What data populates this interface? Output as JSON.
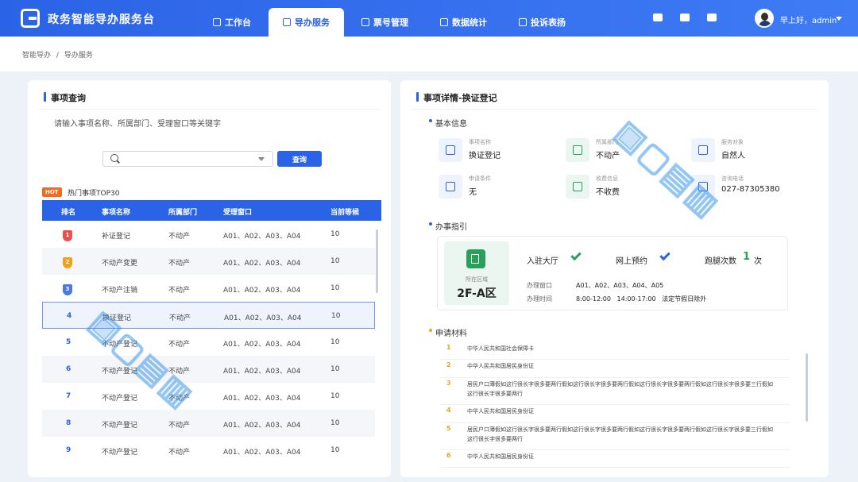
{
  "header": {
    "app_title": "政务智能导办服务台",
    "nav": [
      {
        "label": "工作台"
      },
      {
        "label": "导办服务"
      },
      {
        "label": "票号管理"
      },
      {
        "label": "数据统计"
      },
      {
        "label": "投诉表扬"
      }
    ],
    "greeting": "早上好，admin"
  },
  "breadcrumb": {
    "root": "智能导办",
    "sep": "/",
    "current": "导办服务"
  },
  "left": {
    "title": "事项查询",
    "hint": "请输入事项名称、所属部门、受理窗口等关键字",
    "search_button": "查询",
    "hot_badge": "HOT",
    "hot_title": "热门事项TOP30",
    "columns": [
      "排名",
      "事项名称",
      "所属部门",
      "受理窗口",
      "当前等候"
    ],
    "rows": [
      {
        "rank": "1",
        "name": "补证登记",
        "dept": "不动产",
        "window": "A01、A02、A03、A04",
        "wait": "10"
      },
      {
        "rank": "2",
        "name": "不动产变更",
        "dept": "不动产",
        "window": "A01、A02、A03、A04",
        "wait": "10"
      },
      {
        "rank": "3",
        "name": "不动产注销",
        "dept": "不动产",
        "window": "A01、A02、A03、A04",
        "wait": "10"
      },
      {
        "rank": "4",
        "name": "换证登记",
        "dept": "不动产",
        "window": "A01、A02、A03、A04",
        "wait": "10"
      },
      {
        "rank": "5",
        "name": "不动产登记",
        "dept": "不动产",
        "window": "A01、A02、A03、A04",
        "wait": "10"
      },
      {
        "rank": "6",
        "name": "不动产登记",
        "dept": "不动产",
        "window": "A01、A02、A03、A04",
        "wait": "10"
      },
      {
        "rank": "7",
        "name": "不动产登记",
        "dept": "不动产",
        "window": "A01、A02、A03、A04",
        "wait": "10"
      },
      {
        "rank": "8",
        "name": "不动产登记",
        "dept": "不动产",
        "window": "A01、A02、A03、A04",
        "wait": "10"
      },
      {
        "rank": "9",
        "name": "不动产登记",
        "dept": "不动产",
        "window": "A01、A02、A03、A04",
        "wait": "10"
      }
    ]
  },
  "right": {
    "title": "事项详情-换证登记",
    "basic_section": "基本信息",
    "info": [
      {
        "label": "事项名称",
        "value": "换证登记"
      },
      {
        "label": "所属部门",
        "value": "不动产"
      },
      {
        "label": "服务对象",
        "value": "自然人"
      },
      {
        "label": "申请条件",
        "value": "无"
      },
      {
        "label": "收费信息",
        "value": "不收费"
      },
      {
        "label": "咨询电话",
        "value": "027-87305380"
      }
    ],
    "guide_section": "办事指引",
    "guide": {
      "area_label": "所在区域",
      "area_value": "2F-A区",
      "hall": "入驻大厅",
      "online": "网上预约",
      "visits_label": "跑腿次数",
      "visits_value": "1",
      "visits_unit": "次",
      "window_label": "办理窗口",
      "window_value": "A01、A02、A03、A04、A05",
      "time_label": "办理时间",
      "time_value": "8:00-12:00   14:00-17:00   法定节假日除外"
    },
    "materials_section": "申请材料",
    "materials": [
      {
        "no": "1",
        "text": "中华人民共和国社会保障卡"
      },
      {
        "no": "2",
        "text": "中华人民共和国居民身份证"
      },
      {
        "no": "3",
        "text": "居民户口薄假如这行很长字很多要两行假如这行很长字很多要两行假如这行很长字很多要两行假如这行很长字很多要三行假如这行很长字很多要两行"
      },
      {
        "no": "4",
        "text": "中华人民共和国居民身份证"
      },
      {
        "no": "5",
        "text": "居民户口薄假如这行很长字很多要两行假如这行很长字很多要两行假如这行很长字很多要两行假如这行很长字很多要三行假如这行很长字很多要两行"
      },
      {
        "no": "6",
        "text": "中华人民共和国居民身份证"
      }
    ]
  },
  "colors": {
    "primary": "#2b63e6",
    "green": "#29a05a",
    "orange": "#f0a21b",
    "hot": "#f36b21"
  }
}
